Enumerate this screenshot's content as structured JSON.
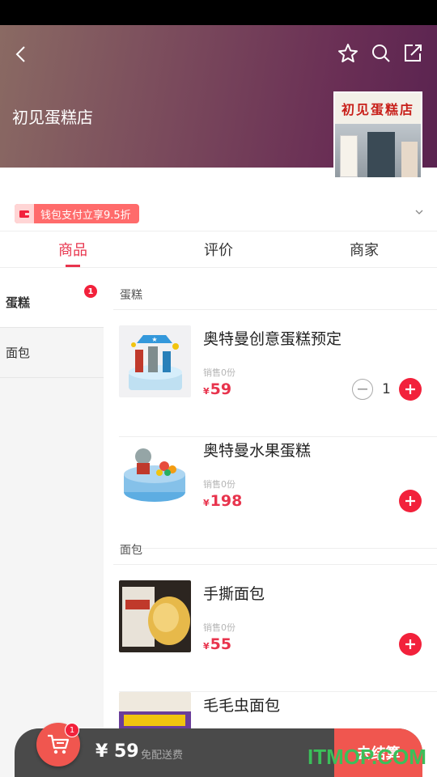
{
  "header": {
    "shop_name": "初见蛋糕店",
    "shop_sign": "初见蛋糕店"
  },
  "promo": {
    "text": "钱包支付立享9.5折"
  },
  "tabs": [
    {
      "label": "商品",
      "active": true
    },
    {
      "label": "评价",
      "active": false
    },
    {
      "label": "商家",
      "active": false
    }
  ],
  "sidebar": {
    "items": [
      {
        "label": "蛋糕",
        "badge": "1",
        "active": true
      },
      {
        "label": "面包",
        "badge": null,
        "active": false
      }
    ]
  },
  "sections": [
    {
      "title": "蛋糕",
      "products": [
        {
          "name": "奥特曼创意蛋糕预定",
          "sales": "销售0份",
          "currency": "¥",
          "price": "59",
          "quantity": "1"
        },
        {
          "name": "奥特曼水果蛋糕",
          "sales": "销售0份",
          "currency": "¥",
          "price": "198"
        }
      ]
    },
    {
      "title": "面包",
      "products": [
        {
          "name": "手撕面包",
          "sales": "销售0份",
          "currency": "¥",
          "price": "55"
        },
        {
          "name": "毛毛虫面包"
        }
      ]
    }
  ],
  "cart": {
    "badge": "1",
    "total": "¥ 59",
    "delivery": "免配送费",
    "checkout_label": "去结算"
  },
  "watermark": "ITMOP.COM",
  "colors": {
    "accent": "#e8344d",
    "cart_bar": "#4a4a4a",
    "checkout": "#f0564f"
  }
}
